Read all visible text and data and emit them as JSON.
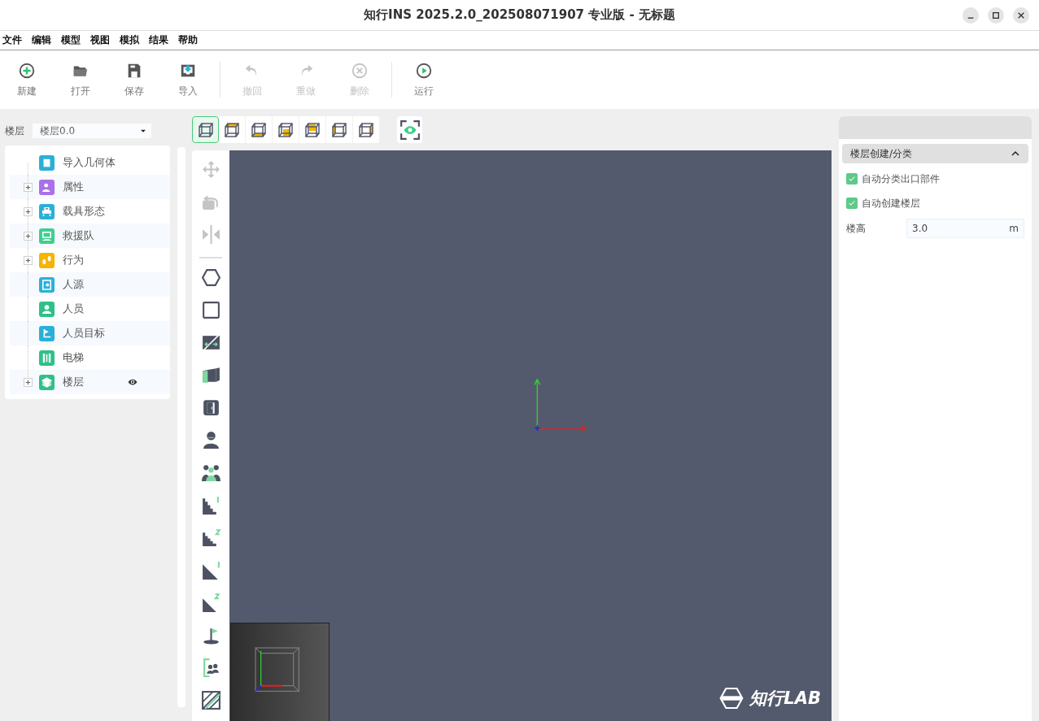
{
  "window": {
    "title": "知行INS 2025.2.0_202508071907 专业版 - 无标题"
  },
  "menu": [
    "文件",
    "编辑",
    "模型",
    "视图",
    "模拟",
    "结果",
    "帮助"
  ],
  "toolbar": [
    {
      "label": "新建",
      "kind": "new",
      "disabled": false
    },
    {
      "label": "打开",
      "kind": "open",
      "disabled": false
    },
    {
      "label": "保存",
      "kind": "save",
      "disabled": false
    },
    {
      "label": "导入",
      "kind": "import",
      "disabled": false
    },
    {
      "label": "撤回",
      "kind": "undo",
      "disabled": true
    },
    {
      "label": "重做",
      "kind": "redo",
      "disabled": true
    },
    {
      "label": "删除",
      "kind": "delete",
      "disabled": true
    },
    {
      "label": "运行",
      "kind": "run",
      "disabled": false
    }
  ],
  "floor_selector": {
    "label": "楼层",
    "value": "楼层0.0"
  },
  "tree": [
    {
      "label": "导入几何体",
      "kind": "leaf",
      "color": "#2ab0d8",
      "visible": false
    },
    {
      "label": "属性",
      "kind": "group",
      "expanded": false,
      "color": "#a970e8",
      "visible": false
    },
    {
      "label": "载具形态",
      "kind": "group",
      "expanded": false,
      "color": "#2ab0d8",
      "visible": false
    },
    {
      "label": "救援队",
      "kind": "group",
      "expanded": false,
      "color": "#3ecf8e",
      "visible": false
    },
    {
      "label": "行为",
      "kind": "group",
      "expanded": false,
      "color": "#f5b400",
      "visible": false
    },
    {
      "label": "人源",
      "kind": "leaf",
      "color": "#2ab0d8",
      "visible": false
    },
    {
      "label": "人员",
      "kind": "leaf",
      "color": "#2fc08a",
      "visible": false
    },
    {
      "label": "人员目标",
      "kind": "leaf",
      "color": "#2ab0d8",
      "visible": false
    },
    {
      "label": "电梯",
      "kind": "leaf",
      "color": "#2fc08a",
      "visible": false
    },
    {
      "label": "楼层",
      "kind": "group",
      "expanded": false,
      "color": "#2fc08a",
      "visible": true
    }
  ],
  "view_buttons": [
    {
      "kind": "iso",
      "selected": true
    },
    {
      "kind": "top",
      "selected": false
    },
    {
      "kind": "bottom",
      "selected": false
    },
    {
      "kind": "front",
      "selected": false
    },
    {
      "kind": "back",
      "selected": false
    },
    {
      "kind": "left",
      "selected": false
    },
    {
      "kind": "right",
      "selected": false
    }
  ],
  "tools": [
    {
      "kind": "move",
      "disabled": true
    },
    {
      "kind": "rotate",
      "disabled": true
    },
    {
      "kind": "mirror",
      "disabled": true
    },
    {
      "kind": "polygon",
      "disabled": false
    },
    {
      "kind": "rect",
      "disabled": false
    },
    {
      "kind": "link",
      "disabled": false
    },
    {
      "kind": "wall",
      "disabled": false
    },
    {
      "kind": "door",
      "disabled": false
    },
    {
      "kind": "person",
      "disabled": false
    },
    {
      "kind": "group",
      "disabled": false
    },
    {
      "kind": "stair1",
      "disabled": false
    },
    {
      "kind": "stair2",
      "disabled": false
    },
    {
      "kind": "ramp1",
      "disabled": false
    },
    {
      "kind": "ramp2",
      "disabled": false
    },
    {
      "kind": "target",
      "disabled": false
    },
    {
      "kind": "source",
      "disabled": false
    },
    {
      "kind": "obstacle",
      "disabled": false
    }
  ],
  "viewport": {
    "logo": "知行LAB"
  },
  "properties": {
    "section": {
      "title": "楼层创建/分类",
      "expanded": true
    },
    "checkboxes": [
      {
        "label": "自动分类出口部件",
        "checked": true
      },
      {
        "label": "自动创建楼层",
        "checked": true
      }
    ],
    "field": {
      "label": "楼高",
      "value": "3.0",
      "unit": "m"
    }
  }
}
